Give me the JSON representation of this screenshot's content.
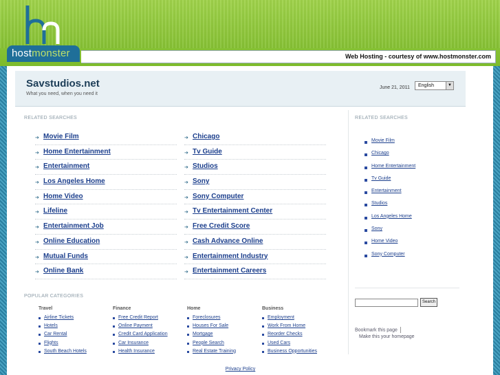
{
  "header": {
    "logo_text_host": "host",
    "logo_text_monster": "monster",
    "hosting_note": "Web Hosting - courtesy of www.hostmonster.com"
  },
  "site": {
    "title": "Savstudios.net",
    "tagline": "What you need, when you need it",
    "date": "June 21, 2011",
    "language": "English"
  },
  "related": {
    "heading_left": "RELATED SEARCHES",
    "heading_right": "RELATED SEARCHES",
    "col_a": [
      "Movie Film",
      "Home Entertainment",
      "Entertainment",
      "Los Angeles Home",
      "Home Video",
      "Lifeline",
      "Entertainment Job",
      "Online Education",
      "Mutual Funds",
      "Online Bank"
    ],
    "col_b": [
      "Chicago",
      "Tv Guide",
      "Studios",
      "Sony",
      "Sony Computer",
      "Tv Entertainment Center",
      "Free Credit Score",
      "Cash Advance Online",
      "Entertainment Industry",
      "Entertainment Careers"
    ],
    "side": [
      "Movie Film",
      "Chicago",
      "Home Entertainment",
      "Tv Guide",
      "Entertainment",
      "Studios",
      "Los Angeles Home",
      "Sony",
      "Home Video",
      "Sony Computer"
    ]
  },
  "search": {
    "button": "Search",
    "value": ""
  },
  "bookmark": {
    "bookmark_label": "Bookmark this page",
    "homepage_label": "Make this your homepage"
  },
  "popular": {
    "heading": "POPULAR CATEGORIES",
    "categories": [
      {
        "name": "Travel",
        "items": [
          "Airline Tickets",
          "Hotels",
          "Car Rental",
          "Flights",
          "South Beach Hotels"
        ]
      },
      {
        "name": "Finance",
        "items": [
          "Free Credit Report",
          "Online Payment",
          "Credit Card Application",
          "Car Insurance",
          "Health Insurance"
        ]
      },
      {
        "name": "Home",
        "items": [
          "Foreclosures",
          "Houses For Sale",
          "Mortgage",
          "People Search",
          "Real Estate Training"
        ]
      },
      {
        "name": "Business",
        "items": [
          "Employment",
          "Work From Home",
          "Reorder Checks",
          "Used Cars",
          "Business Opportunities"
        ]
      }
    ]
  },
  "footer": {
    "privacy": "Privacy Policy"
  },
  "colors": {
    "brand_green": "#8cc63f",
    "brand_blue": "#1f6f99",
    "link": "#1b3e8c"
  }
}
